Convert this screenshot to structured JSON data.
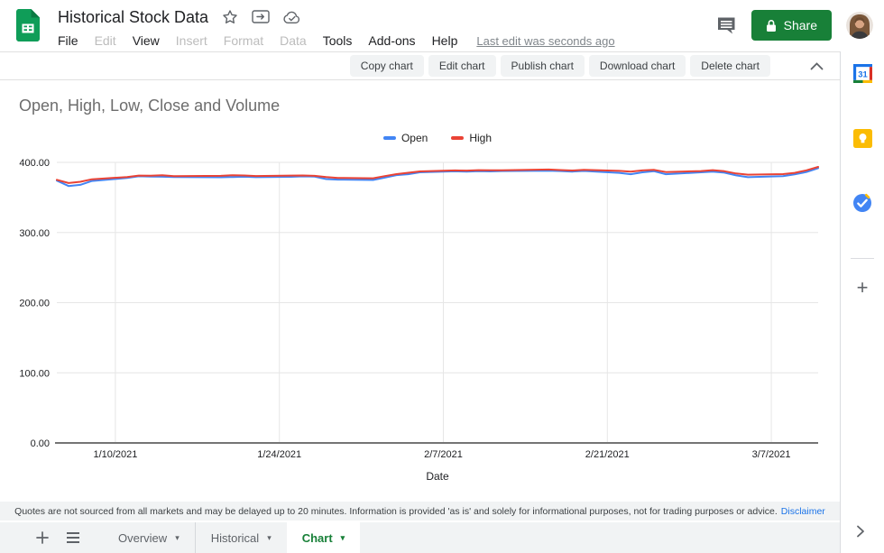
{
  "header": {
    "doc_title": "Historical Stock Data",
    "menu": [
      {
        "label": "File",
        "enabled": true
      },
      {
        "label": "Edit",
        "enabled": false
      },
      {
        "label": "View",
        "enabled": true
      },
      {
        "label": "Insert",
        "enabled": false
      },
      {
        "label": "Format",
        "enabled": false
      },
      {
        "label": "Data",
        "enabled": false
      },
      {
        "label": "Tools",
        "enabled": true
      },
      {
        "label": "Add-ons",
        "enabled": true
      },
      {
        "label": "Help",
        "enabled": true
      }
    ],
    "last_edit": "Last edit was seconds ago",
    "share_label": "Share"
  },
  "chart_toolbar": {
    "buttons": [
      "Copy chart",
      "Edit chart",
      "Publish chart",
      "Download chart",
      "Delete chart"
    ]
  },
  "disclaimer": {
    "text": "Quotes are not sourced from all markets and may be delayed up to 20 minutes. Information is provided 'as is' and solely for informational purposes, not for trading purposes or advice.",
    "link_label": "Disclaimer"
  },
  "tabbar": {
    "tabs": [
      {
        "label": "Overview",
        "active": false
      },
      {
        "label": "Historical",
        "active": false
      },
      {
        "label": "Chart",
        "active": true
      }
    ]
  },
  "side_panel": {
    "icons": [
      "google-calendar",
      "google-keep",
      "google-tasks"
    ],
    "calendar_day": "31"
  },
  "colors": {
    "accent_green": "#188038",
    "series_open": "#4285f4",
    "series_high": "#ea4335",
    "gridline": "#e6e6e6",
    "axis_line": "#757575"
  },
  "chart_data": {
    "type": "line",
    "title": "Open, High, Low, Close and Volume",
    "xlabel": "Date",
    "ylabel": "",
    "ylim": [
      0,
      400
    ],
    "grid": true,
    "legend_position": "top-center",
    "y_ticks": [
      {
        "value": 0,
        "label": "0.00"
      },
      {
        "value": 100,
        "label": "100.00"
      },
      {
        "value": 200,
        "label": "200.00"
      },
      {
        "value": 300,
        "label": "300.00"
      },
      {
        "value": 400,
        "label": "400.00"
      }
    ],
    "x_ticks": [
      "1/10/2021",
      "1/24/2021",
      "2/7/2021",
      "2/21/2021",
      "3/7/2021"
    ],
    "x": [
      "1/5/2021",
      "1/6/2021",
      "1/7/2021",
      "1/8/2021",
      "1/11/2021",
      "1/12/2021",
      "1/13/2021",
      "1/14/2021",
      "1/15/2021",
      "1/19/2021",
      "1/20/2021",
      "1/21/2021",
      "1/22/2021",
      "1/25/2021",
      "1/26/2021",
      "1/27/2021",
      "1/28/2021",
      "1/29/2021",
      "2/1/2021",
      "2/2/2021",
      "2/3/2021",
      "2/4/2021",
      "2/5/2021",
      "2/8/2021",
      "2/9/2021",
      "2/10/2021",
      "2/11/2021",
      "2/12/2021",
      "2/16/2021",
      "2/17/2021",
      "2/18/2021",
      "2/19/2021",
      "2/22/2021",
      "2/23/2021",
      "2/24/2021",
      "2/25/2021",
      "2/26/2021",
      "3/1/2021",
      "3/2/2021",
      "3/3/2021",
      "3/4/2021",
      "3/5/2021",
      "3/8/2021",
      "3/9/2021",
      "3/10/2021",
      "3/11/2021"
    ],
    "series": [
      {
        "name": "Open",
        "color": "#4285f4",
        "values": [
          374.0,
          366.3,
          368.0,
          373.5,
          377.8,
          380.2,
          379.8,
          379.6,
          379.0,
          378.8,
          379.2,
          379.5,
          378.9,
          379.4,
          380.1,
          379.7,
          376.2,
          375.4,
          374.9,
          378.3,
          381.9,
          383.1,
          385.8,
          387.3,
          386.9,
          387.5,
          387.2,
          387.6,
          388.2,
          387.7,
          386.9,
          387.8,
          385.1,
          383.2,
          385.9,
          387.4,
          383.1,
          385.8,
          386.7,
          385.4,
          381.5,
          378.9,
          380.4,
          382.9,
          386.3,
          391.8
        ]
      },
      {
        "name": "High",
        "color": "#ea4335",
        "values": [
          375.2,
          370.5,
          372.3,
          376.0,
          379.2,
          381.2,
          381.0,
          381.6,
          380.3,
          380.9,
          381.7,
          381.4,
          380.6,
          381.2,
          381.4,
          380.9,
          379.2,
          377.9,
          377.3,
          380.4,
          383.3,
          385.2,
          387.1,
          388.6,
          388.3,
          388.9,
          388.7,
          388.8,
          389.8,
          389.1,
          388.4,
          389.4,
          387.9,
          386.7,
          388.5,
          389.3,
          386.2,
          387.6,
          388.9,
          387.4,
          384.2,
          382.5,
          383.3,
          385.1,
          388.7,
          393.6
        ]
      }
    ]
  }
}
